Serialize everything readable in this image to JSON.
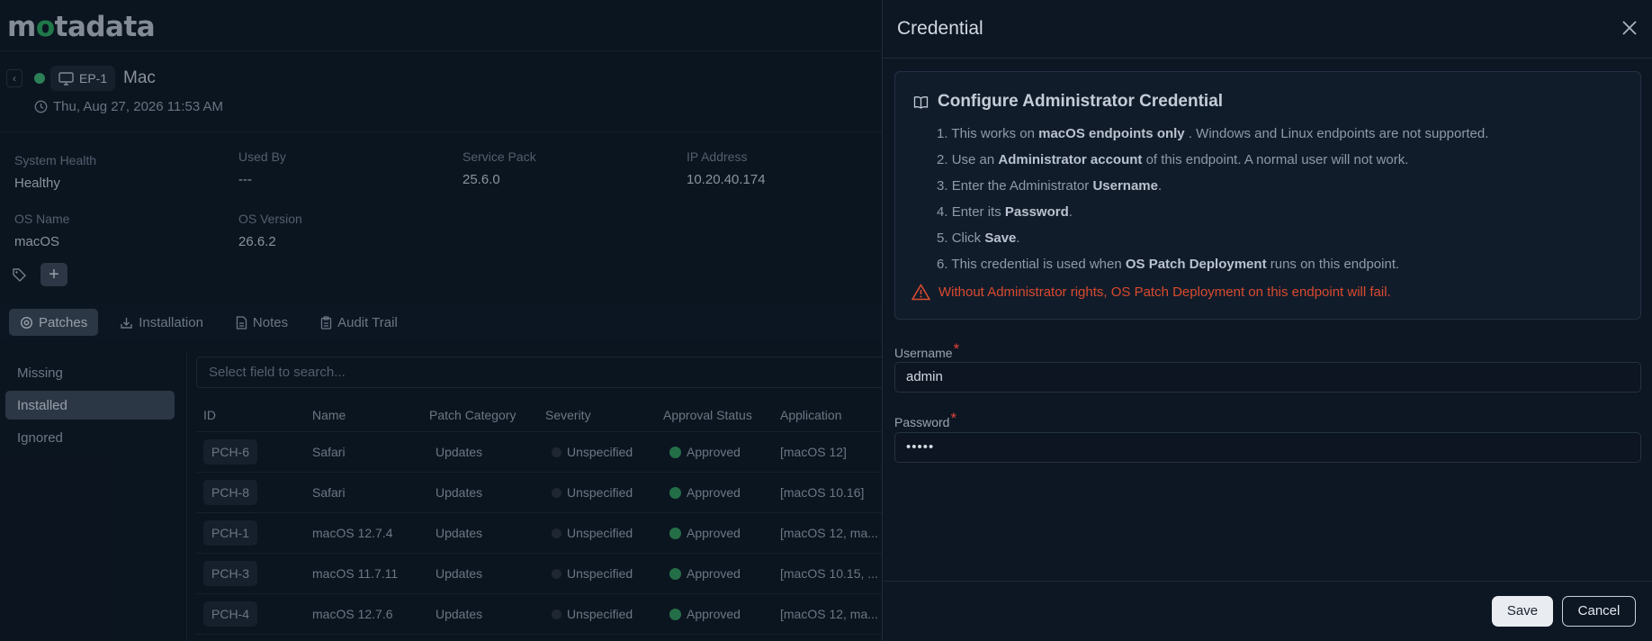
{
  "app": {
    "logo_text": "motadata"
  },
  "endpoint": {
    "chip_label": "EP-1",
    "name": "Mac",
    "timestamp": "Thu, Aug 27, 2026 11:53 AM",
    "status_color": "#3aa76d"
  },
  "meta": {
    "system_health": {
      "label": "System Health",
      "value": "Healthy"
    },
    "used_by": {
      "label": "Used By",
      "value": "---"
    },
    "service_pack": {
      "label": "Service Pack",
      "value": "25.6.0"
    },
    "ip_address": {
      "label": "IP Address",
      "value": "10.20.40.174"
    },
    "os_name": {
      "label": "OS Name",
      "value": "macOS"
    },
    "os_version": {
      "label": "OS Version",
      "value": "26.6.2"
    }
  },
  "tabs": [
    {
      "label": "Patches",
      "icon": "patch-icon",
      "active": true
    },
    {
      "label": "Installation",
      "icon": "install-icon",
      "active": false
    },
    {
      "label": "Notes",
      "icon": "notes-icon",
      "active": false
    },
    {
      "label": "Audit Trail",
      "icon": "clipboard-icon",
      "active": false
    }
  ],
  "sidebar": {
    "items": [
      {
        "label": "Missing",
        "active": false
      },
      {
        "label": "Installed",
        "active": true
      },
      {
        "label": "Ignored",
        "active": false
      }
    ]
  },
  "search": {
    "placeholder": "Select field to search..."
  },
  "table": {
    "columns": [
      "ID",
      "Name",
      "Patch Category",
      "Severity",
      "Approval Status",
      "Application"
    ],
    "rows": [
      {
        "id": "PCH-6",
        "name": "Safari",
        "category": "Updates",
        "severity": "Unspecified",
        "approval": "Approved",
        "application": "[macOS 12]"
      },
      {
        "id": "PCH-8",
        "name": "Safari",
        "category": "Updates",
        "severity": "Unspecified",
        "approval": "Approved",
        "application": "[macOS 10.16]"
      },
      {
        "id": "PCH-1",
        "name": "macOS 12.7.4",
        "category": "Updates",
        "severity": "Unspecified",
        "approval": "Approved",
        "application": "[macOS 12, ma..."
      },
      {
        "id": "PCH-3",
        "name": "macOS 11.7.11",
        "category": "Updates",
        "severity": "Unspecified",
        "approval": "Approved",
        "application": "[macOS 10.15, ..."
      },
      {
        "id": "PCH-4",
        "name": "macOS 12.7.6",
        "category": "Updates",
        "severity": "Unspecified",
        "approval": "Approved",
        "application": "[macOS 12, ma..."
      }
    ]
  },
  "drawer": {
    "title": "Credential",
    "info": {
      "title": "Configure Administrator Credential",
      "steps": [
        {
          "n": "1.",
          "a": "This works on ",
          "b": "macOS endpoints only",
          "c": " . Windows and Linux endpoints are not supported."
        },
        {
          "n": "2.",
          "a": "Use an ",
          "b": "Administrator account",
          "c": " of this endpoint. A normal user will not work."
        },
        {
          "n": "3.",
          "a": "Enter the Administrator ",
          "b": "Username",
          "c": "."
        },
        {
          "n": "4.",
          "a": "Enter its ",
          "b": "Password",
          "c": "."
        },
        {
          "n": "5.",
          "a": "Click ",
          "b": "Save",
          "c": "."
        },
        {
          "n": "6.",
          "a": "This credential is used when ",
          "b": "OS Patch Deployment",
          "c": " runs on this endpoint."
        }
      ],
      "warning": "Without Administrator rights, OS Patch Deployment on this endpoint will fail."
    },
    "username": {
      "label": "Username",
      "required_mark": "*",
      "value": "admin"
    },
    "password": {
      "label": "Password",
      "required_mark": "*",
      "value": "•••••"
    },
    "save_label": "Save",
    "cancel_label": "Cancel"
  },
  "colors": {
    "accent_green": "#2f8f59",
    "warning": "#d94a2e",
    "required": "#e0433a"
  }
}
